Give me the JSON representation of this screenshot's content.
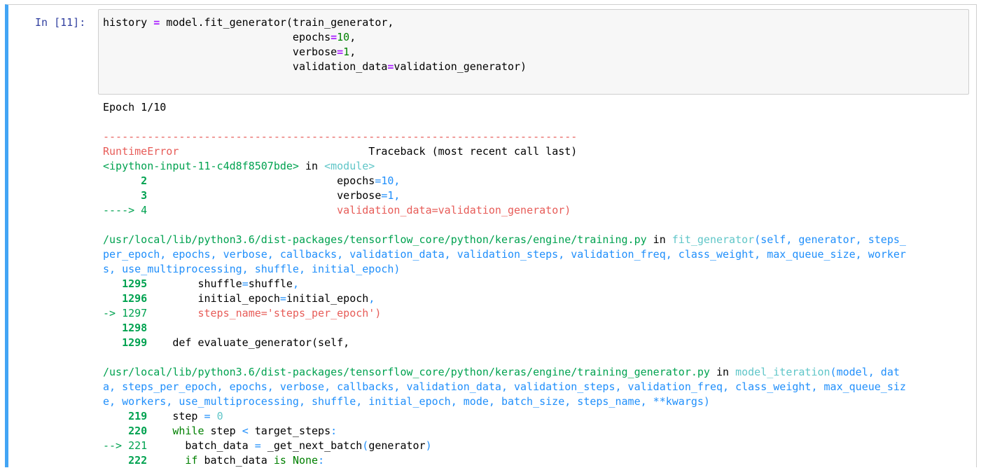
{
  "cell": {
    "prompt": "In [11]:",
    "code_lines": [
      [
        "history",
        " ",
        "=",
        " model.fit_generator(train_generator,"
      ],
      [
        "                              epochs",
        "=",
        "10",
        ","
      ],
      [
        "                              verbose",
        "=",
        "1",
        ","
      ],
      [
        "                              validation_data",
        "=",
        "validation_generator)"
      ]
    ]
  },
  "output": {
    "epoch": "Epoch 1/10",
    "separator": "---------------------------------------------------------------------------",
    "error_name": "RuntimeError",
    "traceback_header": "                              Traceback (most recent call last)",
    "frame0": {
      "input_name": "<ipython-input-11-c4d8f8507bde>",
      "in": " in ",
      "module": "<module>",
      "lines": [
        {
          "num": "      2",
          "code_a": "                              epochs",
          "eq": "=",
          "val": "10",
          "tail": ","
        },
        {
          "num": "      3",
          "code_a": "                              verbose",
          "eq": "=",
          "val": "1",
          "tail": ","
        },
        {
          "arrow": "----> 4",
          "code": "                              validation_data=validation_generator)"
        }
      ]
    },
    "frame1": {
      "path": "/usr/local/lib/python3.6/dist-packages/tensorflow_core/python/keras/engine/training.py",
      "in": " in ",
      "func": "fit_generator",
      "sig1": "(self, generator, steps_",
      "sig2": "per_epoch, epochs, verbose, callbacks, validation_data, validation_steps, validation_freq, class_weight, max_queue_size, worker",
      "sig3": "s, use_multiprocessing, shuffle, initial_epoch)",
      "lines": [
        {
          "num": "   1295",
          "code": "        shuffle",
          "eq": "=",
          "rest": "shuffle",
          "tail": ","
        },
        {
          "num": "   1296",
          "code": "        initial_epoch",
          "eq": "=",
          "rest": "initial_epoch",
          "tail": ","
        },
        {
          "arrow": "-> 1297",
          "code": "        steps_name='steps_per_epoch')"
        },
        {
          "num": "   1298",
          "code": ""
        },
        {
          "num": "   1299",
          "code": "    def evaluate_generator(self,"
        }
      ]
    },
    "frame2": {
      "path": "/usr/local/lib/python3.6/dist-packages/tensorflow_core/python/keras/engine/training_generator.py",
      "in": " in ",
      "func": "model_iteration",
      "sig1": "(model, dat",
      "sig2": "a, steps_per_epoch, epochs, verbose, callbacks, validation_data, validation_steps, validation_freq, class_weight, max_queue_siz",
      "sig3": "e, workers, use_multiprocessing, shuffle, initial_epoch, mode, batch_size, steps_name, **kwargs)",
      "lines": [
        {
          "num": "    219",
          "pre": "    step ",
          "eq": "=",
          "sp": " ",
          "val": "0"
        },
        {
          "num": "    220",
          "kw": "    while",
          "mid": " step ",
          "lt": "<",
          "rest": " target_steps",
          "tail": ":"
        },
        {
          "arrow": "--> 221",
          "pre": "      batch_data ",
          "eq": "=",
          "mid": " _get_next_batch",
          "paren": "(",
          "rest": "generator",
          "paren2": ")"
        },
        {
          "num": "    222",
          "kw": "      if",
          "mid": " batch_data ",
          "kw2": "is",
          "sp": " ",
          "none": "None",
          "tail": ":"
        }
      ]
    }
  }
}
